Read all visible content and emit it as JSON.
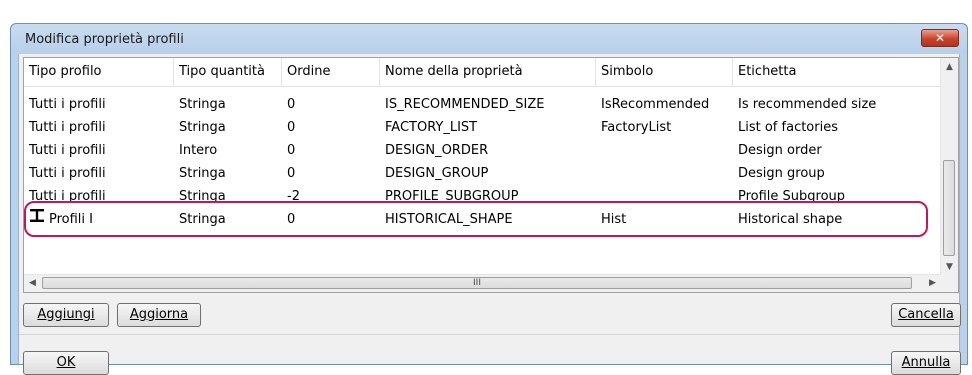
{
  "window": {
    "title": "Modifica proprietà profili",
    "close_label": "✕"
  },
  "table": {
    "columns": [
      "Tipo profilo",
      "Tipo quantità",
      "Ordine",
      "Nome della proprietà",
      "Simbolo",
      "Etichetta"
    ],
    "rows": [
      [
        "Tutti i profili",
        "Stringa",
        "0",
        "IS_RECOMMENDED_SIZE",
        "IsRecommended",
        "Is recommended size"
      ],
      [
        "Tutti i profili",
        "Stringa",
        "0",
        "FACTORY_LIST",
        "FactoryList",
        "List of factories"
      ],
      [
        "Tutti i profili",
        "Intero",
        "0",
        "DESIGN_ORDER",
        "",
        "Design order"
      ],
      [
        "Tutti i profili",
        "Stringa",
        "0",
        "DESIGN_GROUP",
        "",
        "Design group"
      ],
      [
        "Tutti i profili",
        "Stringa",
        "-2",
        "PROFILE_SUBGROUP",
        "",
        "Profile Subgroup"
      ],
      [
        "Profili I",
        "Stringa",
        "0",
        "HISTORICAL_SHAPE",
        "Hist",
        "Historical shape"
      ]
    ],
    "hscroll_thumb_label": "III"
  },
  "buttons": {
    "add": "Aggiungi",
    "update": "Aggiorna",
    "delete": "Cancella",
    "ok": "OK",
    "cancel": "Annulla"
  }
}
